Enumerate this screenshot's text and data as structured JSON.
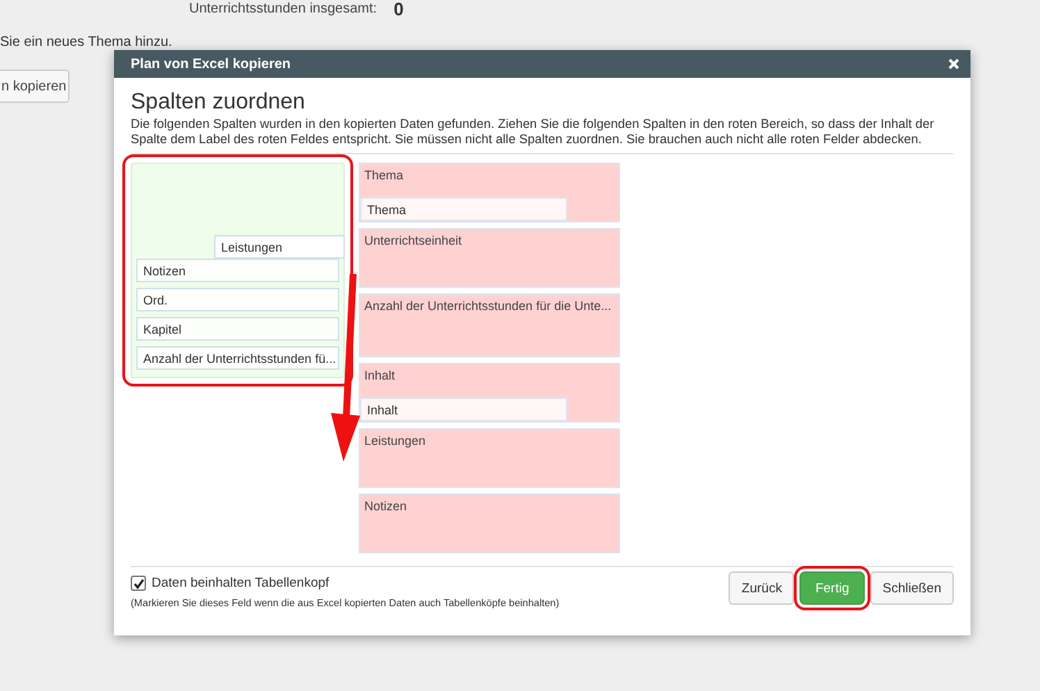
{
  "background": {
    "total_label": "Unterrichtsstunden insgesamt:",
    "total_value": "0",
    "hint": "Sie ein neues Thema hinzu.",
    "button": "n kopieren"
  },
  "dialog": {
    "title": "Plan von Excel kopieren",
    "heading": "Spalten zuordnen",
    "description": "Die folgenden Spalten wurden in den kopierten Daten gefunden. Ziehen Sie die folgenden Spalten in den roten Bereich, so dass der Inhalt der Spalte dem Label des roten Feldes entspricht. Sie müssen nicht alle Spalten zuordnen. Sie brauchen auch nicht alle roten Felder abdecken.",
    "source_columns": [
      {
        "label": "Leistungen",
        "dragging": true
      },
      {
        "label": "Notizen",
        "dragging": false
      },
      {
        "label": "Ord.",
        "dragging": false
      },
      {
        "label": "Kapitel",
        "dragging": false
      },
      {
        "label": "Anzahl der Unterrichtsstunden fü...",
        "dragging": false
      }
    ],
    "targets": [
      {
        "label": "Thema",
        "assigned": "Thema"
      },
      {
        "label": "Unterrichtseinheit"
      },
      {
        "label": "Anzahl der Unterrichtsstunden für die Unte..."
      },
      {
        "label": "Inhalt",
        "assigned": "Inhalt"
      },
      {
        "label": "Leistungen"
      },
      {
        "label": "Notizen"
      }
    ],
    "header_checkbox": {
      "label": "Daten beinhalten Tabellenkopf",
      "checked": true
    },
    "note": "(Markieren Sie dieses Feld wenn die aus Excel kopierten Daten auch Tabellenköpfe beinhalten)",
    "buttons": [
      {
        "label": "Zurück",
        "kind": "default",
        "highlighted": false
      },
      {
        "label": "Fertig",
        "kind": "primary",
        "highlighted": true
      },
      {
        "label": "Schließen",
        "kind": "default",
        "highlighted": false
      }
    ]
  }
}
